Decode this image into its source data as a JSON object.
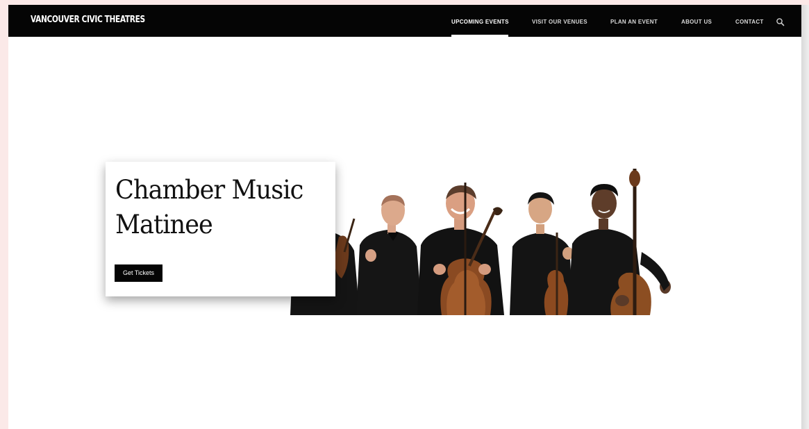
{
  "header": {
    "logo_text": "VANCOUVER CIVIC THEATRES",
    "nav": [
      {
        "label": "UPCOMING EVENTS",
        "active": true
      },
      {
        "label": "VISIT OUR VENUES",
        "active": false
      },
      {
        "label": "PLAN AN EVENT",
        "active": false
      },
      {
        "label": "ABOUT US",
        "active": false
      },
      {
        "label": "CONTACT",
        "active": false
      }
    ],
    "search_icon": "search-icon"
  },
  "hero": {
    "title": "Chamber Music Matinee",
    "cta_label": "Get Tickets",
    "image": "chamber-ensemble-photo"
  },
  "colors": {
    "nav_background": "#050505",
    "page_background": "#ffffff",
    "outer_background": "#fbe9e8",
    "button_background": "#050505",
    "button_text": "#ffffff"
  }
}
